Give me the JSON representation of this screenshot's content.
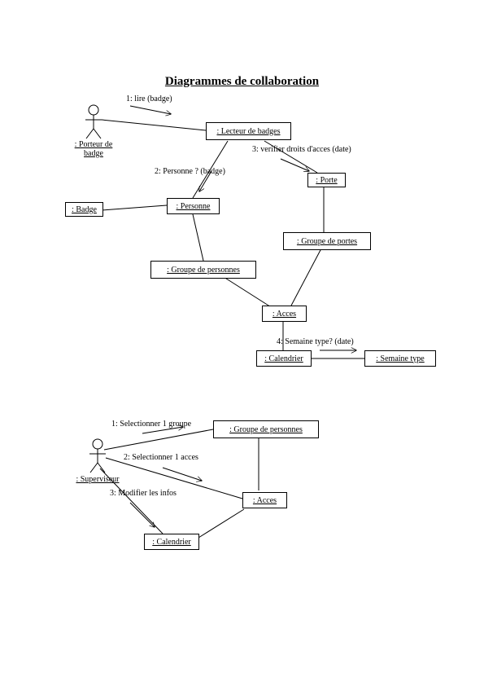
{
  "title": "Diagrammes de collaboration",
  "diagram1": {
    "actor": ": Porteur de badge",
    "messages": {
      "m1": "1: lire (badge)",
      "m2": "2: Personne ? (badge)",
      "m3": "3: verifier droits d'acces (date)",
      "m4": "4: Semaine type? (date)"
    },
    "objects": {
      "lecteur": ": Lecteur de badges",
      "porte": ": Porte",
      "badge": ": Badge",
      "personne": ": Personne",
      "gpersonnes": ": Groupe de personnes",
      "gportes": ": Groupe de portes",
      "acces": ": Acces",
      "calendrier": ": Calendrier",
      "semaine": ": Semaine type"
    }
  },
  "diagram2": {
    "actor": ": Superviseur",
    "messages": {
      "m1": "1: Selectionner 1 groupe",
      "m2": "2: Selectionner 1 acces",
      "m3": "3: Modifier les infos"
    },
    "objects": {
      "gpersonnes": ": Groupe de personnes",
      "acces": ": Acces",
      "calendrier": ": Calendrier"
    }
  }
}
